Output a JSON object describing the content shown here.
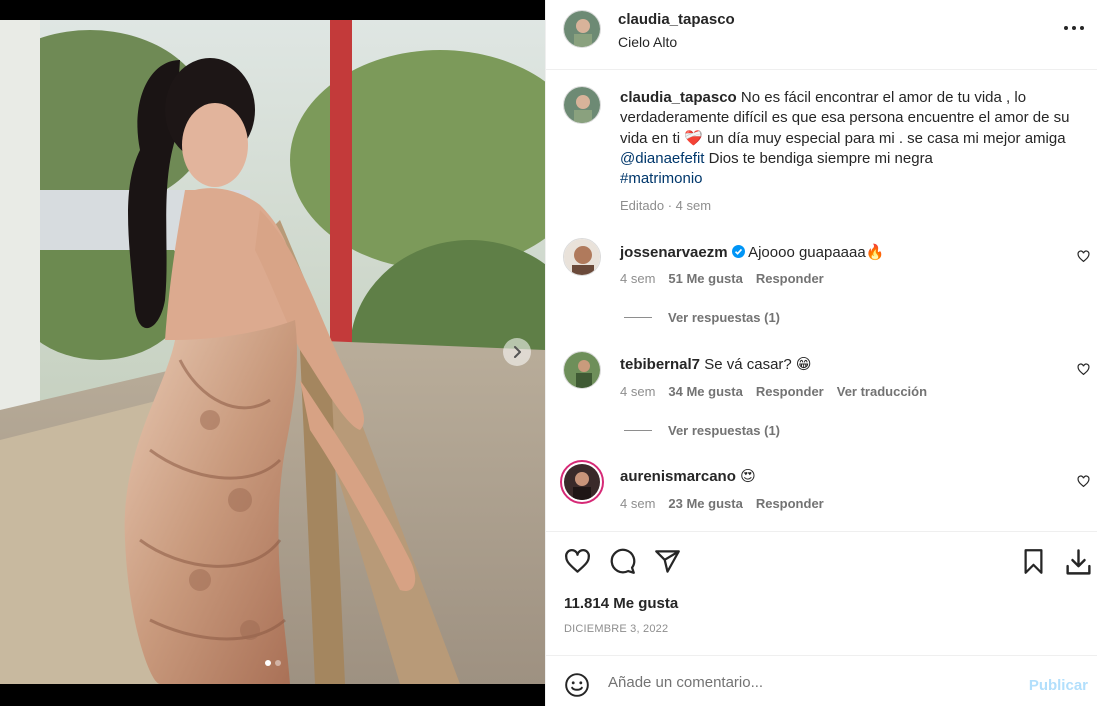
{
  "post": {
    "username": "claudia_tapasco",
    "location": "Cielo Alto",
    "carousel": {
      "total_slides": 2,
      "current_slide": 1
    },
    "caption": {
      "username": "claudia_tapasco",
      "text_1": "No es fácil encontrar el amor de tu vida , lo verdaderamente difícil es que esa persona encuentre el amor de su vida en ti ",
      "emoji_heart": "❤️‍🩹",
      "text_2": " un día muy especial para mi . se casa mi mejor amiga ",
      "mention": "@dianaefefit",
      "text_3": " Dios te bendiga siempre mi negra",
      "hashtag": "#matrimonio",
      "meta": "Editado · 4 sem"
    },
    "comments": [
      {
        "username": "jossenarvaezm",
        "verified": true,
        "text": "Ajoooo guapaaaa🔥",
        "time": "4 sem",
        "likes": "51 Me gusta",
        "reply": "Responder",
        "translate": "",
        "view_replies": "Ver respuestas (1)"
      },
      {
        "username": "tebibernal7",
        "verified": false,
        "text": "Se vá casar? 😁",
        "time": "4 sem",
        "likes": "34 Me gusta",
        "reply": "Responder",
        "translate": "Ver traducción",
        "view_replies": "Ver respuestas (1)"
      },
      {
        "username": "aurenismarcano",
        "verified": false,
        "text": "😍",
        "time": "4 sem",
        "likes": "23 Me gusta",
        "reply": "Responder",
        "translate": "",
        "view_replies": ""
      }
    ],
    "likes_count": "11.814 Me gusta",
    "date": "DICIEMBRE 3, 2022",
    "comment_placeholder": "Añade un comentario...",
    "publish_label": "Publicar"
  },
  "colors": {
    "link": "#00376b",
    "verified": "#0095f6",
    "publish_disabled": "#b2dffc",
    "story_ring": "#d62976"
  },
  "icons": [
    "more-options-icon",
    "heart-icon",
    "comment-icon",
    "share-icon",
    "bookmark-icon",
    "download-icon",
    "emoji-icon",
    "chevron-right-icon",
    "verified-badge-icon"
  ]
}
